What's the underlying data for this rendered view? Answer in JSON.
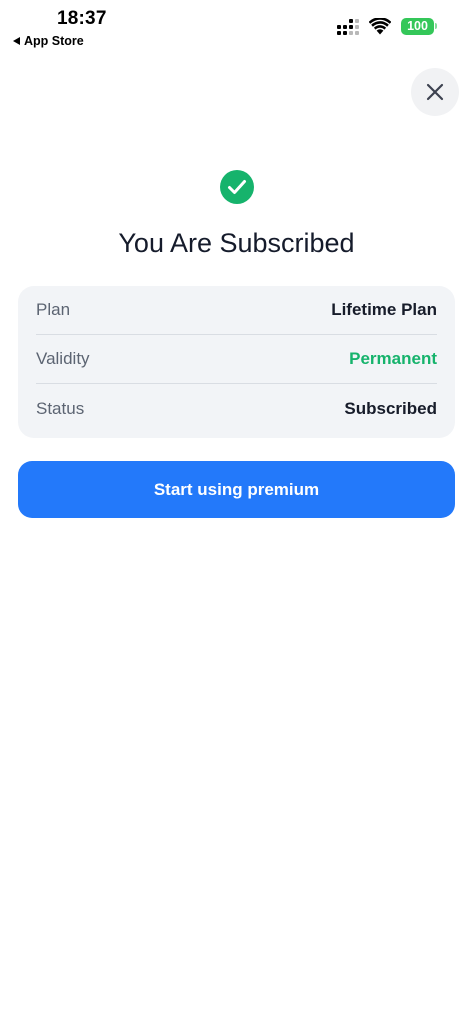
{
  "status_bar": {
    "time": "18:37",
    "back_label": "App Store",
    "battery_level": "100",
    "battery_color": "#34c759"
  },
  "header": {
    "close_icon": "close-icon"
  },
  "main": {
    "check_icon": "check-circle-icon",
    "check_color": "#16b36c",
    "title": "You Are Subscribed",
    "details": [
      {
        "label": "Plan",
        "value": "Lifetime Plan"
      },
      {
        "label": "Validity",
        "value": "Permanent",
        "value_color": "#16b36c"
      },
      {
        "label": "Status",
        "value": "Subscribed"
      }
    ],
    "cta_label": "Start using premium",
    "cta_color": "#2379fa"
  }
}
